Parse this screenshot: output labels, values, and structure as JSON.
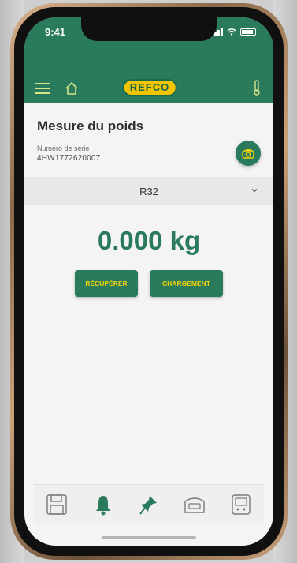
{
  "status_bar": {
    "time": "9:41"
  },
  "header": {
    "logo_text": "REFCO"
  },
  "page": {
    "title": "Mesure du poids",
    "serial_label": "Numéro de série",
    "serial_value": "4HW1772620007"
  },
  "refrigerant_select": {
    "selected": "R32"
  },
  "measurement": {
    "weight": "0.000 kg"
  },
  "actions": {
    "recover_label": "RÉCUPÉRER",
    "charge_label": "CHARGEMENT"
  },
  "bottom_nav": [
    {
      "icon": "floppy-disk-icon"
    },
    {
      "icon": "bell-icon"
    },
    {
      "icon": "pin-icon"
    },
    {
      "icon": "scale-icon"
    },
    {
      "icon": "device-icon"
    }
  ],
  "colors": {
    "primary_green": "#2a7a5c",
    "accent_yellow": "#f3d10a",
    "logo_yellow": "#f3c400"
  }
}
